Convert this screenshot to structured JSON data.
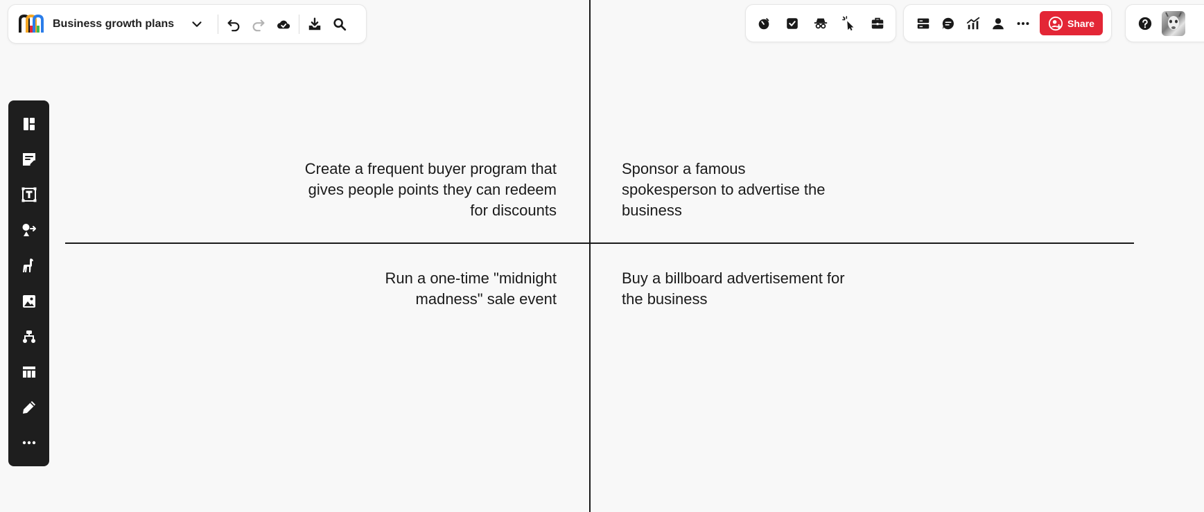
{
  "board": {
    "title": "Business growth plans"
  },
  "header": {
    "share_label": "Share"
  },
  "icons": {
    "undo": "undo-icon",
    "redo": "redo-icon",
    "cloud": "cloud-saved-icon",
    "download": "download-icon",
    "search": "search-icon",
    "timer": "timer-icon",
    "vote": "checkbox-icon",
    "private": "private-mode-icon",
    "pointer": "pointer-icon",
    "toolkit": "briefcase-icon",
    "outline": "outline-icon",
    "comments": "comment-icon",
    "activity": "chart-icon",
    "people": "person-icon",
    "more": "more-icon",
    "help": "help-icon"
  },
  "quadrants": {
    "top_left": "Create a frequent buyer program that gives people points they can redeem for discounts",
    "top_right": "Sponsor a famous spokesperson to advertise the business",
    "bottom_left": "Run a one-time \"midnight madness\" sale event",
    "bottom_right": "Buy a billboard advertisement for the business"
  },
  "colors": {
    "share_button": "#e32636",
    "toolbar_bg": "#1e1e1e",
    "canvas_bg": "#f8f8f8"
  }
}
